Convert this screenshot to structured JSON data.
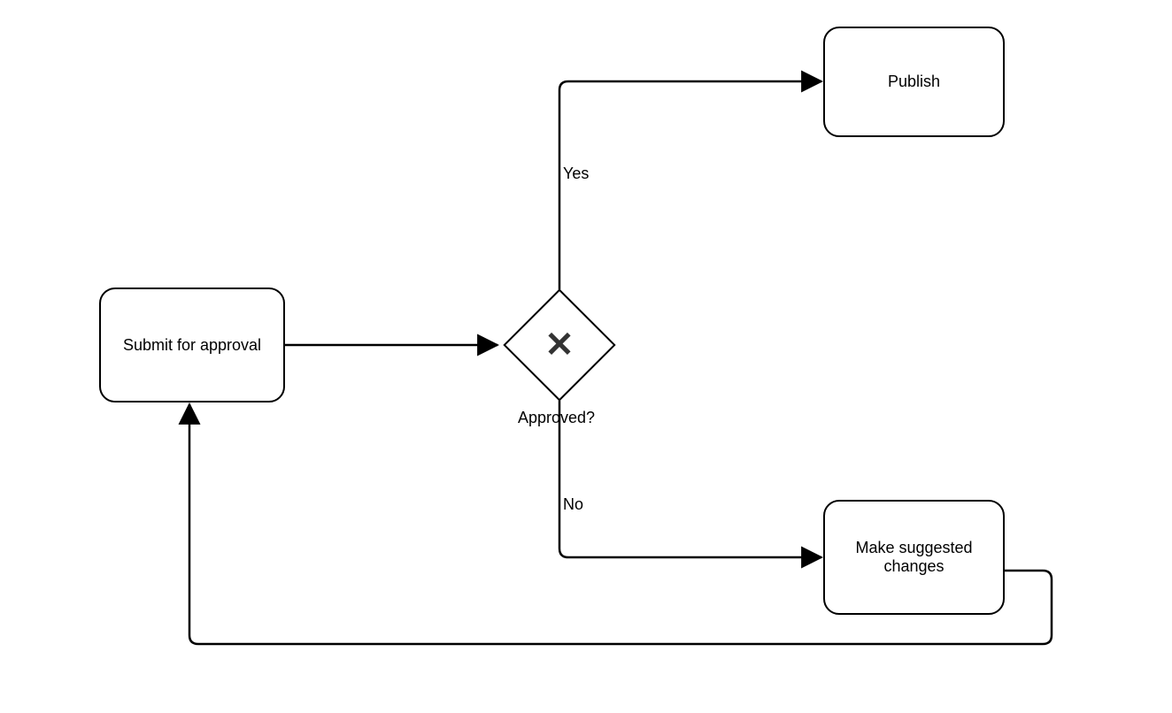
{
  "nodes": {
    "submit": {
      "label": "Submit for approval"
    },
    "publish": {
      "label": "Publish"
    },
    "changes": {
      "label": "Make suggested changes"
    }
  },
  "decision": {
    "label": "Approved?",
    "glyph": "✕"
  },
  "edges": {
    "yes": {
      "label": "Yes"
    },
    "no": {
      "label": "No"
    }
  }
}
